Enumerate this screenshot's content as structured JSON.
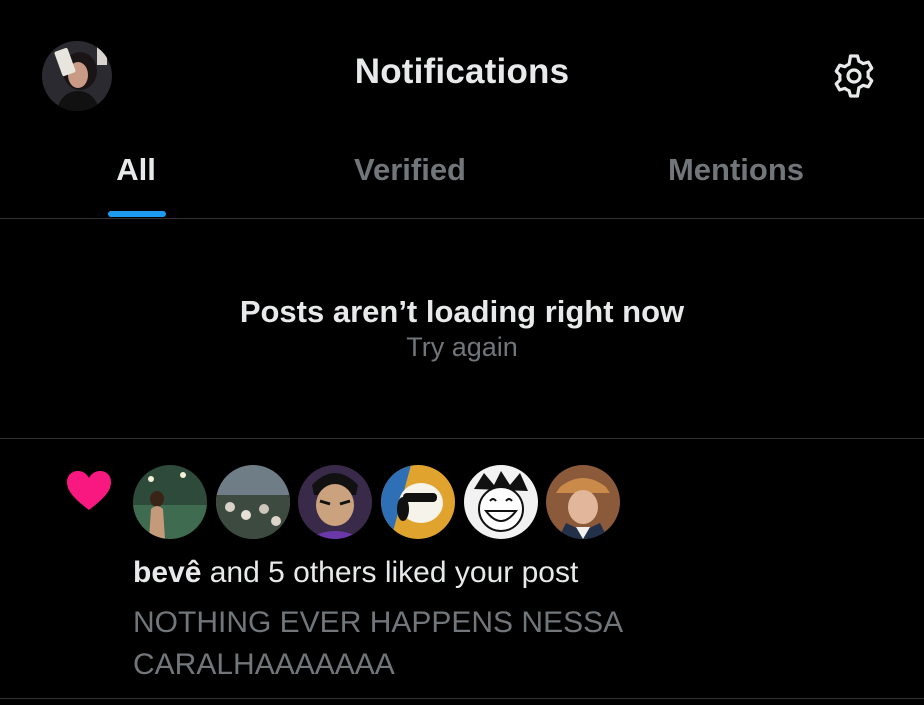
{
  "header": {
    "title": "Notifications",
    "profile_icon": "user-avatar",
    "settings_icon": "gear-icon"
  },
  "tabs": [
    {
      "label": "All",
      "active": true
    },
    {
      "label": "Verified",
      "active": false
    },
    {
      "label": "Mentions",
      "active": false
    }
  ],
  "error": {
    "title": "Posts aren’t loading right now",
    "retry_label": "Try again"
  },
  "notification": {
    "icon": "heart-icon",
    "user": "bevê",
    "action": " and 5 others liked your post",
    "post_text": "NOTHING EVER HAPPENS NESSA CARALHAAAAAAA",
    "liker_count": 6
  },
  "colors": {
    "background": "#000000",
    "text_primary": "#e7e9ea",
    "text_secondary": "#71767b",
    "accent": "#1d9bf0",
    "like": "#f91880",
    "divider": "#2f3336"
  }
}
